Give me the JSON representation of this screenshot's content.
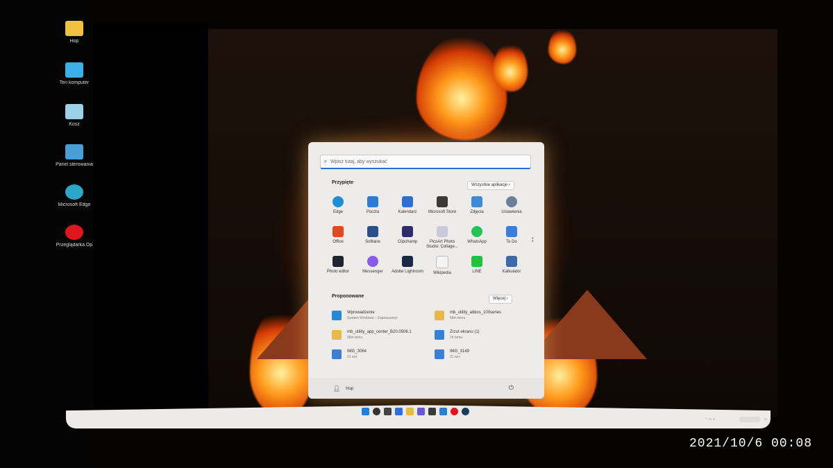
{
  "desktop": {
    "icons": [
      {
        "label": "Hop",
        "icon": "folder-icon",
        "color": "#f0c040"
      },
      {
        "label": "Ten komputer",
        "icon": "computer-icon",
        "color": "#3ab0e8"
      },
      {
        "label": "Kosz",
        "icon": "recycle-bin-icon",
        "color": "#9ccfe8"
      },
      {
        "label": "Panel sterowania",
        "icon": "control-panel-icon",
        "color": "#4a9ed6"
      },
      {
        "label": "Microsoft Edge",
        "icon": "edge-icon",
        "color": "#2aa6c8"
      },
      {
        "label": "Przeglądarka Op",
        "icon": "opera-icon",
        "color": "#e0161e"
      }
    ]
  },
  "start_menu": {
    "search_placeholder": "Wpisz tutaj, aby wyszukać",
    "pinned_title": "Przypięte",
    "all_apps_label": "Wszystkie aplikacje",
    "pinned": [
      {
        "label": "Edge",
        "icon": "edge-icon",
        "color": "#1d8fd6"
      },
      {
        "label": "Poczta",
        "icon": "mail-icon",
        "color": "#2c7cd4"
      },
      {
        "label": "Kalendarz",
        "icon": "calendar-icon",
        "color": "#2d6fd0"
      },
      {
        "label": "Microsoft Store",
        "icon": "store-icon",
        "color": "#3a3a3a"
      },
      {
        "label": "Zdjęcia",
        "icon": "photos-icon",
        "color": "#3b8bd9"
      },
      {
        "label": "Ustawienia",
        "icon": "settings-icon",
        "color": "#6a7f9a"
      },
      {
        "label": "Office",
        "icon": "office-icon",
        "color": "#e04a1e"
      },
      {
        "label": "Solitaire",
        "icon": "solitaire-icon",
        "color": "#2a4f8a"
      },
      {
        "label": "Clipchamp",
        "icon": "clipchamp-icon",
        "color": "#2e2a6e"
      },
      {
        "label": "PicsArt Photo Studio: Collage...",
        "icon": "picsart-icon",
        "color": "#c9c9d8"
      },
      {
        "label": "WhatsApp",
        "icon": "whatsapp-icon",
        "color": "#27c15a"
      },
      {
        "label": "To Do",
        "icon": "todo-icon",
        "color": "#3a7ce0"
      },
      {
        "label": "Photo editor",
        "icon": "photo-editor-icon",
        "color": "#1e2430"
      },
      {
        "label": "Messenger",
        "icon": "messenger-icon",
        "color": "#8a5ae8"
      },
      {
        "label": "Adobe Lightroom",
        "icon": "lightroom-icon",
        "color": "#1b2a44"
      },
      {
        "label": "Wikipedia",
        "icon": "wikipedia-icon",
        "color": "#f4f4f4"
      },
      {
        "label": "LINE",
        "icon": "line-icon",
        "color": "#22c23c"
      },
      {
        "label": "Kalkulator",
        "icon": "calculator-icon",
        "color": "#3c6aa8"
      }
    ],
    "recommended_title": "Proponowane",
    "more_label": "Więcej",
    "recommended": [
      {
        "title": "Wprowadzenie",
        "subtitle": "System Windows – Zapraszamy!",
        "icon": "get-started-icon",
        "color": "#2a86d8"
      },
      {
        "title": "mb_utility_atbios_100series",
        "subtitle": "58m temu",
        "icon": "folder-icon",
        "color": "#e8b84a"
      },
      {
        "title": "mb_utility_app_center_B20.0506.1",
        "subtitle": "58m temu",
        "icon": "folder-icon",
        "color": "#e8b84a"
      },
      {
        "title": "Zrzut ekranu (1)",
        "subtitle": "1h temu",
        "icon": "image-file-icon",
        "color": "#3a7fd0"
      },
      {
        "title": "IMG_3064",
        "subtitle": "21 wrz",
        "icon": "image-file-icon",
        "color": "#3a7fd0"
      },
      {
        "title": "IMG_3149",
        "subtitle": "21 wrz",
        "icon": "image-file-icon",
        "color": "#3a7fd0"
      }
    ],
    "user_name": "Hop"
  },
  "taskbar": {
    "icons": [
      {
        "icon": "start-icon",
        "color": "#1f7fe0"
      },
      {
        "icon": "search-icon",
        "color": "#333333"
      },
      {
        "icon": "task-view-icon",
        "color": "#444444"
      },
      {
        "icon": "widgets-icon",
        "color": "#2f6fd8"
      },
      {
        "icon": "file-explorer-icon",
        "color": "#e8b84a"
      },
      {
        "icon": "teams-icon",
        "color": "#6a5ad0"
      },
      {
        "icon": "store-icon",
        "color": "#3a3a3a"
      },
      {
        "icon": "mail-icon",
        "color": "#2c7cd4"
      },
      {
        "icon": "opera-icon",
        "color": "#e0161e"
      },
      {
        "icon": "steam-icon",
        "color": "#1b3a5e"
      }
    ]
  },
  "photo_timestamp": "2021/10/6 00:08"
}
